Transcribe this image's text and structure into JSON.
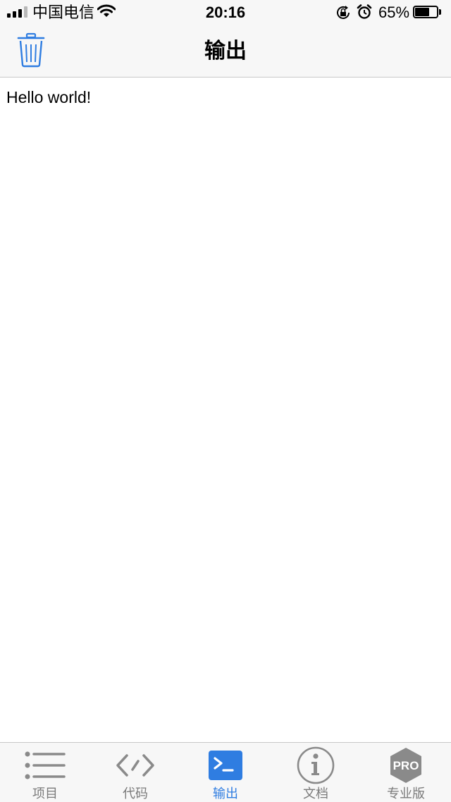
{
  "status_bar": {
    "carrier": "中国电信",
    "time": "20:16",
    "battery_percent": "65%",
    "battery_level": 0.65,
    "signal_bars_on": 3,
    "signal_bars_total": 4
  },
  "nav_bar": {
    "title": "输出",
    "trash_icon": "trash-icon"
  },
  "output": {
    "text": "Hello world!"
  },
  "tab_bar": {
    "tabs": [
      {
        "label": "项目",
        "icon": "list-icon",
        "active": false
      },
      {
        "label": "代码",
        "icon": "code-icon",
        "active": false
      },
      {
        "label": "输出",
        "icon": "terminal-icon",
        "active": true
      },
      {
        "label": "文档",
        "icon": "info-icon",
        "active": false
      },
      {
        "label": "专业版",
        "icon": "pro-badge-icon",
        "active": false,
        "badge": "PRO"
      }
    ]
  },
  "colors": {
    "accent": "#2f7de1",
    "inactive": "#7a7a7a",
    "bar_background": "#f7f7f7"
  }
}
